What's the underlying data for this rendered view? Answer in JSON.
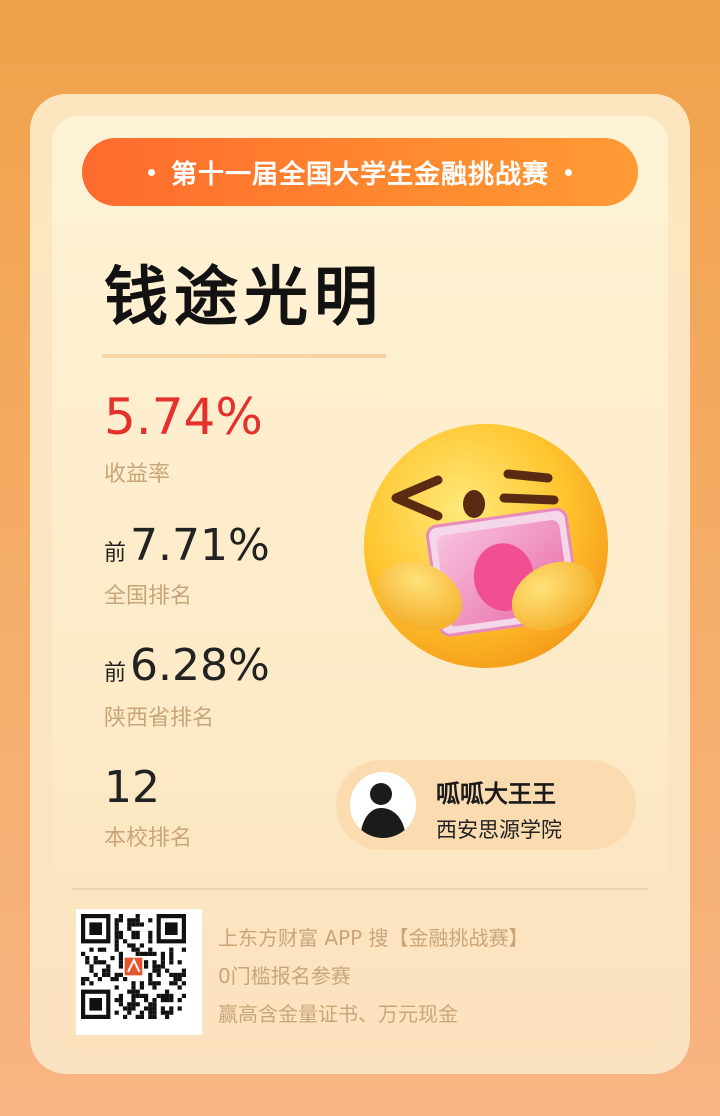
{
  "banner": {
    "text": "第十一届全国大学生金融挑战赛"
  },
  "title": "钱途光明",
  "stats": {
    "return": {
      "value": "5.74%",
      "label": "收益率"
    },
    "national": {
      "prefix": "前",
      "value": "7.71%",
      "label": "全国排名"
    },
    "province": {
      "prefix": "前",
      "value": "6.28%",
      "label": "陕西省排名"
    },
    "school": {
      "value": "12",
      "label": "本校排名"
    }
  },
  "user": {
    "name": "呱呱大王王",
    "school": "西安思源学院"
  },
  "promo": {
    "line1": "上东方财富 APP 搜【金融挑战赛】",
    "line2": "0门槛报名参赛",
    "line3": "赢高含金量证书、万元现金"
  },
  "colors": {
    "accent_red": "#e4312b",
    "banner_orange": "#ff7a2f",
    "label_tan": "#c9a57a"
  },
  "icons": {
    "emoji": "money-hug-emoji-icon",
    "qr": "qr-code-icon",
    "avatar": "avatar-silhouette-icon"
  }
}
